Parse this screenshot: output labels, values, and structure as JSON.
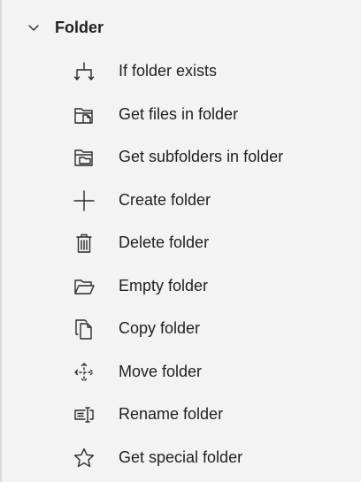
{
  "group": {
    "title": "Folder",
    "expanded": true
  },
  "items": [
    {
      "label": "If folder exists",
      "icon": "branch-icon"
    },
    {
      "label": "Get files in folder",
      "icon": "get-files-icon"
    },
    {
      "label": "Get subfolders in folder",
      "icon": "get-subfolders-icon"
    },
    {
      "label": "Create folder",
      "icon": "plus-icon"
    },
    {
      "label": "Delete folder",
      "icon": "trash-icon"
    },
    {
      "label": "Empty folder",
      "icon": "open-folder-icon"
    },
    {
      "label": "Copy folder",
      "icon": "copy-icon"
    },
    {
      "label": "Move folder",
      "icon": "move-icon"
    },
    {
      "label": "Rename folder",
      "icon": "rename-icon"
    },
    {
      "label": "Get special folder",
      "icon": "star-icon"
    }
  ]
}
